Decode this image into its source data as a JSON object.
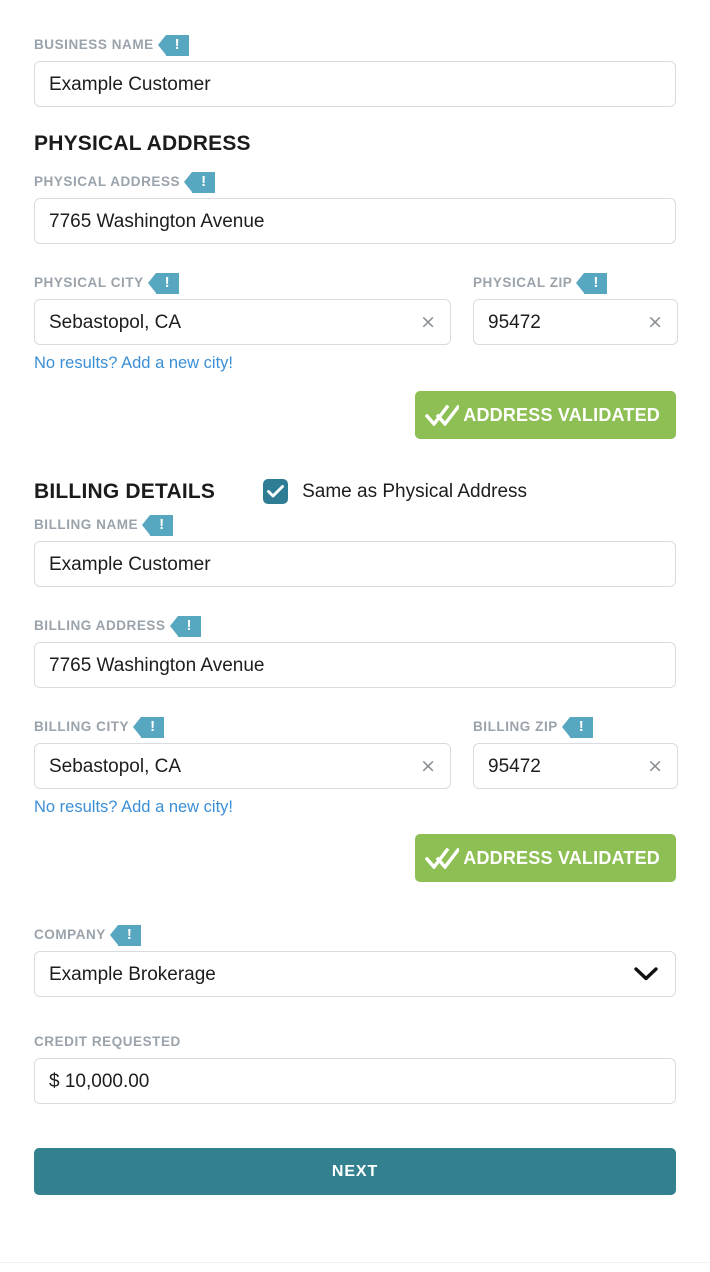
{
  "colors": {
    "badge_teal": "#56a7bf",
    "checkbox_teal": "#2e7d94",
    "validated_green": "#8dbf54",
    "next_teal": "#33808f",
    "link_blue": "#3b8fd6",
    "label_gray": "#9aa3ab",
    "input_border": "#d9dbde"
  },
  "badge": {
    "glyph": "!",
    "name": "required-indicator"
  },
  "business": {
    "label": "BUSINESS NAME",
    "value": "Example Customer"
  },
  "physical_section": {
    "heading": "PHYSICAL ADDRESS",
    "address": {
      "label": "PHYSICAL ADDRESS",
      "value": "7765 Washington Avenue"
    },
    "city": {
      "label": "PHYSICAL CITY",
      "value": "Sebastopol, CA",
      "clear_glyph": "×"
    },
    "zip": {
      "label": "PHYSICAL ZIP",
      "value": "95472",
      "clear_glyph": "×"
    },
    "helper_link": "No results? Add a new city!",
    "validated_label": "ADDRESS VALIDATED"
  },
  "billing_section": {
    "heading": "BILLING DETAILS",
    "same_as_physical": {
      "label": "Same as Physical Address",
      "checked": true
    },
    "name": {
      "label": "BILLING NAME",
      "value": "Example Customer"
    },
    "address": {
      "label": "BILLING ADDRESS",
      "value": "7765 Washington Avenue"
    },
    "city": {
      "label": "BILLING CITY",
      "value": "Sebastopol, CA",
      "clear_glyph": "×"
    },
    "zip": {
      "label": "BILLING ZIP",
      "value": "95472",
      "clear_glyph": "×"
    },
    "helper_link": "No results? Add a new city!",
    "validated_label": "ADDRESS VALIDATED"
  },
  "company": {
    "label": "COMPANY",
    "value": "Example Brokerage",
    "options": [
      "Example Brokerage"
    ]
  },
  "credit": {
    "label": "CREDIT REQUESTED",
    "value": "$ 10,000.00"
  },
  "footer": {
    "next_label": "NEXT"
  }
}
